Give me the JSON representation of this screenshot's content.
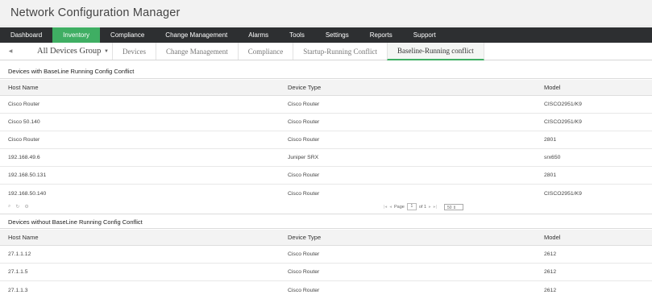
{
  "app": {
    "title": "Network Configuration Manager"
  },
  "main_nav": [
    {
      "label": "Dashboard",
      "active": false
    },
    {
      "label": "Inventory",
      "active": true
    },
    {
      "label": "Compliance",
      "active": false
    },
    {
      "label": "Change Management",
      "active": false
    },
    {
      "label": "Alarms",
      "active": false
    },
    {
      "label": "Tools",
      "active": false
    },
    {
      "label": "Settings",
      "active": false
    },
    {
      "label": "Reports",
      "active": false
    },
    {
      "label": "Support",
      "active": false
    }
  ],
  "sub_tabs": {
    "group_label": "All Devices Group",
    "tabs": [
      {
        "label": "Devices"
      },
      {
        "label": "Change Management"
      },
      {
        "label": "Compliance"
      },
      {
        "label": "Startup-Running Conflict"
      },
      {
        "label": "Baseline-Running conflict"
      }
    ],
    "active_tab": "Baseline-Running conflict"
  },
  "conflict_section": {
    "title": "Devices with BaseLine Running Config Conflict",
    "columns": [
      "Host Name",
      "Device Type",
      "Model"
    ],
    "rows": [
      [
        "Cisco Router",
        "Cisco Router",
        "CISCO2951/K9"
      ],
      [
        "Cisco 50.140",
        "Cisco Router",
        "CISCO2951/K9"
      ],
      [
        "Cisco Router",
        "Cisco Router",
        "2801"
      ],
      [
        "192.168.49.6",
        "Juniper SRX",
        "srx650"
      ],
      [
        "192.168.50.131",
        "Cisco Router",
        "2801"
      ],
      [
        "192.168.50.140",
        "Cisco Router",
        "CISCO2951/K9"
      ]
    ]
  },
  "pager": {
    "page_label": "Page",
    "page_value": "1",
    "of_label": "of 1",
    "page_size": "50"
  },
  "no_conflict_section": {
    "title": "Devices without BaseLine Running Config Conflict",
    "columns": [
      "Host Name",
      "Device Type",
      "Model"
    ],
    "rows": [
      [
        "27.1.1.12",
        "Cisco Router",
        "2612"
      ],
      [
        "27.1.1.5",
        "Cisco Router",
        "2612"
      ],
      [
        "27.1.1.3",
        "Cisco Router",
        "2612"
      ]
    ]
  },
  "colors": {
    "accent": "#3fae63",
    "nav_bg": "#2d2f31"
  }
}
